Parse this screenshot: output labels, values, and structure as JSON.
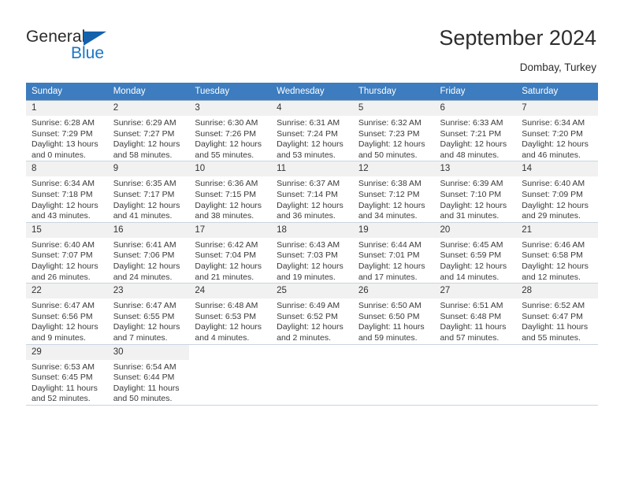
{
  "logo": {
    "word_one": "General",
    "word_two": "Blue",
    "triangle_icon": "blue-triangle-icon",
    "brand_dark": "#2b2b2b",
    "brand_blue": "#1a76c4"
  },
  "header": {
    "title": "September 2024",
    "location": "Dombay, Turkey",
    "header_bg": "#3c7cbf",
    "daynum_bg": "#f1f1f1"
  },
  "weekday_headers": [
    "Sunday",
    "Monday",
    "Tuesday",
    "Wednesday",
    "Thursday",
    "Friday",
    "Saturday"
  ],
  "labels": {
    "sunrise": "Sunrise:",
    "sunset": "Sunset:",
    "daylight": "Daylight:"
  },
  "weeks": [
    [
      {
        "day": "1",
        "sunrise": "Sunrise: 6:28 AM",
        "sunset": "Sunset: 7:29 PM",
        "daylight_1": "Daylight: 13 hours",
        "daylight_2": "and 0 minutes."
      },
      {
        "day": "2",
        "sunrise": "Sunrise: 6:29 AM",
        "sunset": "Sunset: 7:27 PM",
        "daylight_1": "Daylight: 12 hours",
        "daylight_2": "and 58 minutes."
      },
      {
        "day": "3",
        "sunrise": "Sunrise: 6:30 AM",
        "sunset": "Sunset: 7:26 PM",
        "daylight_1": "Daylight: 12 hours",
        "daylight_2": "and 55 minutes."
      },
      {
        "day": "4",
        "sunrise": "Sunrise: 6:31 AM",
        "sunset": "Sunset: 7:24 PM",
        "daylight_1": "Daylight: 12 hours",
        "daylight_2": "and 53 minutes."
      },
      {
        "day": "5",
        "sunrise": "Sunrise: 6:32 AM",
        "sunset": "Sunset: 7:23 PM",
        "daylight_1": "Daylight: 12 hours",
        "daylight_2": "and 50 minutes."
      },
      {
        "day": "6",
        "sunrise": "Sunrise: 6:33 AM",
        "sunset": "Sunset: 7:21 PM",
        "daylight_1": "Daylight: 12 hours",
        "daylight_2": "and 48 minutes."
      },
      {
        "day": "7",
        "sunrise": "Sunrise: 6:34 AM",
        "sunset": "Sunset: 7:20 PM",
        "daylight_1": "Daylight: 12 hours",
        "daylight_2": "and 46 minutes."
      }
    ],
    [
      {
        "day": "8",
        "sunrise": "Sunrise: 6:34 AM",
        "sunset": "Sunset: 7:18 PM",
        "daylight_1": "Daylight: 12 hours",
        "daylight_2": "and 43 minutes."
      },
      {
        "day": "9",
        "sunrise": "Sunrise: 6:35 AM",
        "sunset": "Sunset: 7:17 PM",
        "daylight_1": "Daylight: 12 hours",
        "daylight_2": "and 41 minutes."
      },
      {
        "day": "10",
        "sunrise": "Sunrise: 6:36 AM",
        "sunset": "Sunset: 7:15 PM",
        "daylight_1": "Daylight: 12 hours",
        "daylight_2": "and 38 minutes."
      },
      {
        "day": "11",
        "sunrise": "Sunrise: 6:37 AM",
        "sunset": "Sunset: 7:14 PM",
        "daylight_1": "Daylight: 12 hours",
        "daylight_2": "and 36 minutes."
      },
      {
        "day": "12",
        "sunrise": "Sunrise: 6:38 AM",
        "sunset": "Sunset: 7:12 PM",
        "daylight_1": "Daylight: 12 hours",
        "daylight_2": "and 34 minutes."
      },
      {
        "day": "13",
        "sunrise": "Sunrise: 6:39 AM",
        "sunset": "Sunset: 7:10 PM",
        "daylight_1": "Daylight: 12 hours",
        "daylight_2": "and 31 minutes."
      },
      {
        "day": "14",
        "sunrise": "Sunrise: 6:40 AM",
        "sunset": "Sunset: 7:09 PM",
        "daylight_1": "Daylight: 12 hours",
        "daylight_2": "and 29 minutes."
      }
    ],
    [
      {
        "day": "15",
        "sunrise": "Sunrise: 6:40 AM",
        "sunset": "Sunset: 7:07 PM",
        "daylight_1": "Daylight: 12 hours",
        "daylight_2": "and 26 minutes."
      },
      {
        "day": "16",
        "sunrise": "Sunrise: 6:41 AM",
        "sunset": "Sunset: 7:06 PM",
        "daylight_1": "Daylight: 12 hours",
        "daylight_2": "and 24 minutes."
      },
      {
        "day": "17",
        "sunrise": "Sunrise: 6:42 AM",
        "sunset": "Sunset: 7:04 PM",
        "daylight_1": "Daylight: 12 hours",
        "daylight_2": "and 21 minutes."
      },
      {
        "day": "18",
        "sunrise": "Sunrise: 6:43 AM",
        "sunset": "Sunset: 7:03 PM",
        "daylight_1": "Daylight: 12 hours",
        "daylight_2": "and 19 minutes."
      },
      {
        "day": "19",
        "sunrise": "Sunrise: 6:44 AM",
        "sunset": "Sunset: 7:01 PM",
        "daylight_1": "Daylight: 12 hours",
        "daylight_2": "and 17 minutes."
      },
      {
        "day": "20",
        "sunrise": "Sunrise: 6:45 AM",
        "sunset": "Sunset: 6:59 PM",
        "daylight_1": "Daylight: 12 hours",
        "daylight_2": "and 14 minutes."
      },
      {
        "day": "21",
        "sunrise": "Sunrise: 6:46 AM",
        "sunset": "Sunset: 6:58 PM",
        "daylight_1": "Daylight: 12 hours",
        "daylight_2": "and 12 minutes."
      }
    ],
    [
      {
        "day": "22",
        "sunrise": "Sunrise: 6:47 AM",
        "sunset": "Sunset: 6:56 PM",
        "daylight_1": "Daylight: 12 hours",
        "daylight_2": "and 9 minutes."
      },
      {
        "day": "23",
        "sunrise": "Sunrise: 6:47 AM",
        "sunset": "Sunset: 6:55 PM",
        "daylight_1": "Daylight: 12 hours",
        "daylight_2": "and 7 minutes."
      },
      {
        "day": "24",
        "sunrise": "Sunrise: 6:48 AM",
        "sunset": "Sunset: 6:53 PM",
        "daylight_1": "Daylight: 12 hours",
        "daylight_2": "and 4 minutes."
      },
      {
        "day": "25",
        "sunrise": "Sunrise: 6:49 AM",
        "sunset": "Sunset: 6:52 PM",
        "daylight_1": "Daylight: 12 hours",
        "daylight_2": "and 2 minutes."
      },
      {
        "day": "26",
        "sunrise": "Sunrise: 6:50 AM",
        "sunset": "Sunset: 6:50 PM",
        "daylight_1": "Daylight: 11 hours",
        "daylight_2": "and 59 minutes."
      },
      {
        "day": "27",
        "sunrise": "Sunrise: 6:51 AM",
        "sunset": "Sunset: 6:48 PM",
        "daylight_1": "Daylight: 11 hours",
        "daylight_2": "and 57 minutes."
      },
      {
        "day": "28",
        "sunrise": "Sunrise: 6:52 AM",
        "sunset": "Sunset: 6:47 PM",
        "daylight_1": "Daylight: 11 hours",
        "daylight_2": "and 55 minutes."
      }
    ],
    [
      {
        "day": "29",
        "sunrise": "Sunrise: 6:53 AM",
        "sunset": "Sunset: 6:45 PM",
        "daylight_1": "Daylight: 11 hours",
        "daylight_2": "and 52 minutes."
      },
      {
        "day": "30",
        "sunrise": "Sunrise: 6:54 AM",
        "sunset": "Sunset: 6:44 PM",
        "daylight_1": "Daylight: 11 hours",
        "daylight_2": "and 50 minutes."
      },
      {
        "day": "",
        "sunrise": "",
        "sunset": "",
        "daylight_1": "",
        "daylight_2": ""
      },
      {
        "day": "",
        "sunrise": "",
        "sunset": "",
        "daylight_1": "",
        "daylight_2": ""
      },
      {
        "day": "",
        "sunrise": "",
        "sunset": "",
        "daylight_1": "",
        "daylight_2": ""
      },
      {
        "day": "",
        "sunrise": "",
        "sunset": "",
        "daylight_1": "",
        "daylight_2": ""
      },
      {
        "day": "",
        "sunrise": "",
        "sunset": "",
        "daylight_1": "",
        "daylight_2": ""
      }
    ]
  ]
}
